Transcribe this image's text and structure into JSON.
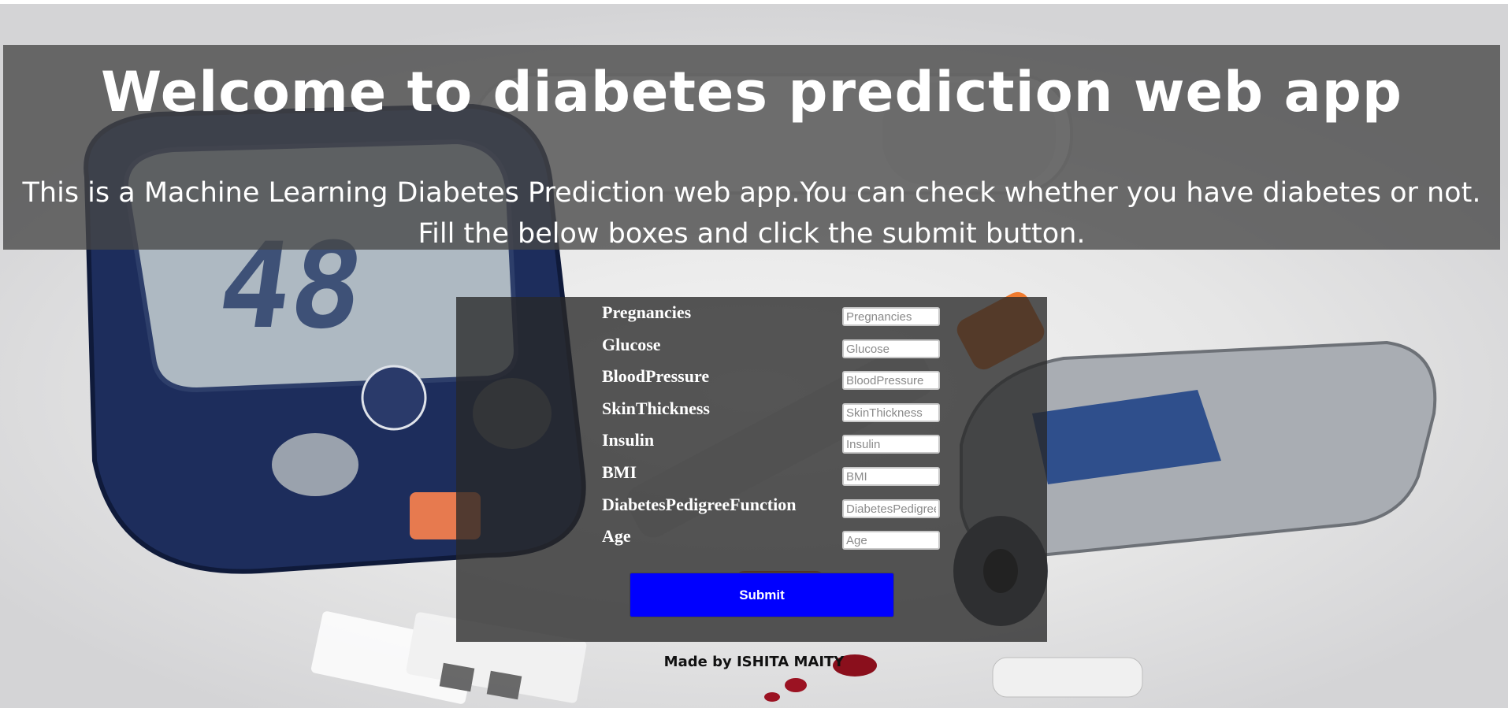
{
  "header": {
    "title": "Welcome to diabetes prediction web app",
    "intro": "This is a Machine Learning Diabetes Prediction web app.You can check whether you have diabetes or not. Fill the below boxes and click the submit button."
  },
  "form": {
    "fields": [
      {
        "label": "Pregnancies",
        "placeholder": "Pregnancies",
        "value": ""
      },
      {
        "label": "Glucose",
        "placeholder": "Glucose",
        "value": ""
      },
      {
        "label": "BloodPressure",
        "placeholder": "BloodPressure",
        "value": ""
      },
      {
        "label": "SkinThickness",
        "placeholder": "SkinThickness",
        "value": ""
      },
      {
        "label": "Insulin",
        "placeholder": "Insulin",
        "value": ""
      },
      {
        "label": "BMI",
        "placeholder": "BMI",
        "value": ""
      },
      {
        "label": "DiabetesPedigreeFunction",
        "placeholder": "DiabetesPedigreeFunction",
        "value": ""
      },
      {
        "label": "Age",
        "placeholder": "Age",
        "value": ""
      }
    ],
    "submit_label": "Submit"
  },
  "footer": {
    "credit": "Made by ISHITA MAITY"
  },
  "colors": {
    "submit_bg": "#0000ff",
    "overlay": "#464646",
    "text_light": "#ffffff"
  },
  "background": {
    "device_screen_reading": "48"
  }
}
